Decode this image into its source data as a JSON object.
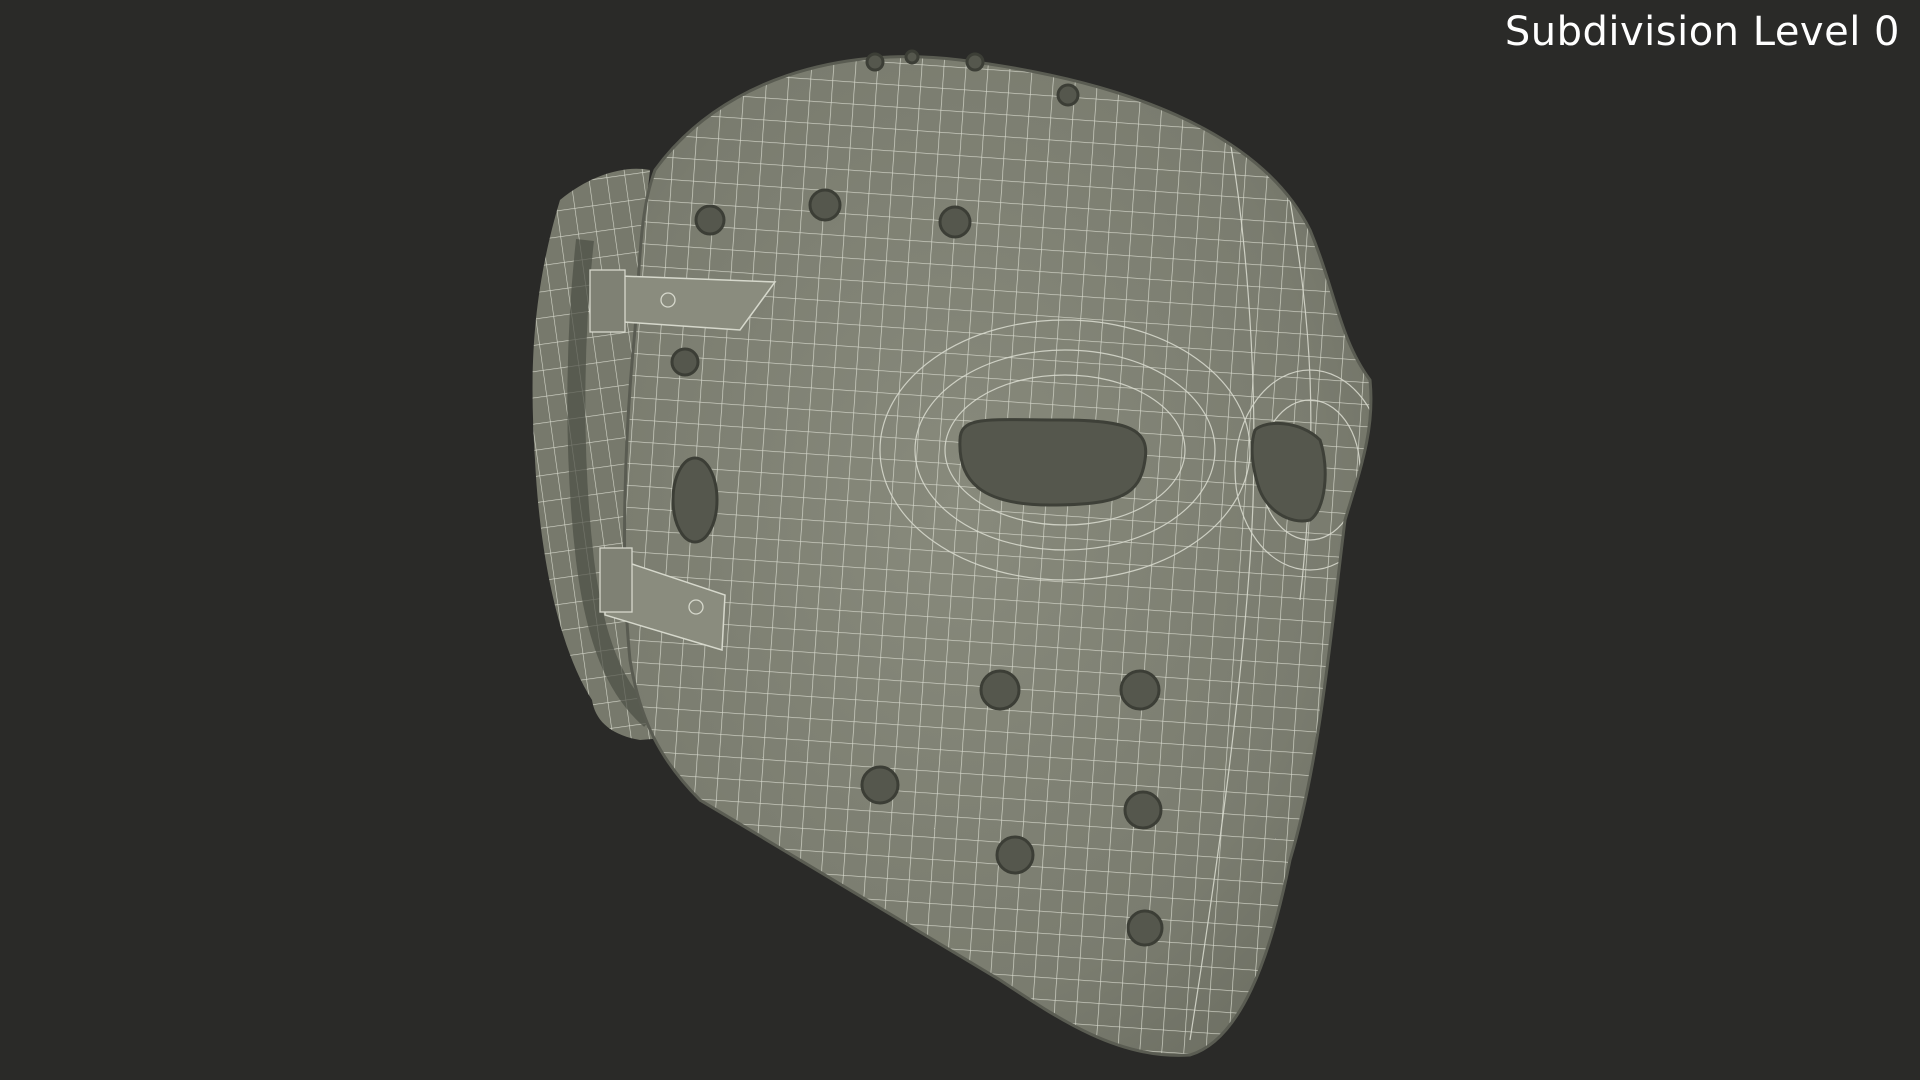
{
  "overlay": {
    "label": "Subdivision Level 0"
  },
  "model": {
    "subject": "hockey-goalie-mask-wireframe",
    "mesh_color": "#7d7f71",
    "wire_color": "#d9dbcf",
    "background_color": "#2a2a28"
  }
}
